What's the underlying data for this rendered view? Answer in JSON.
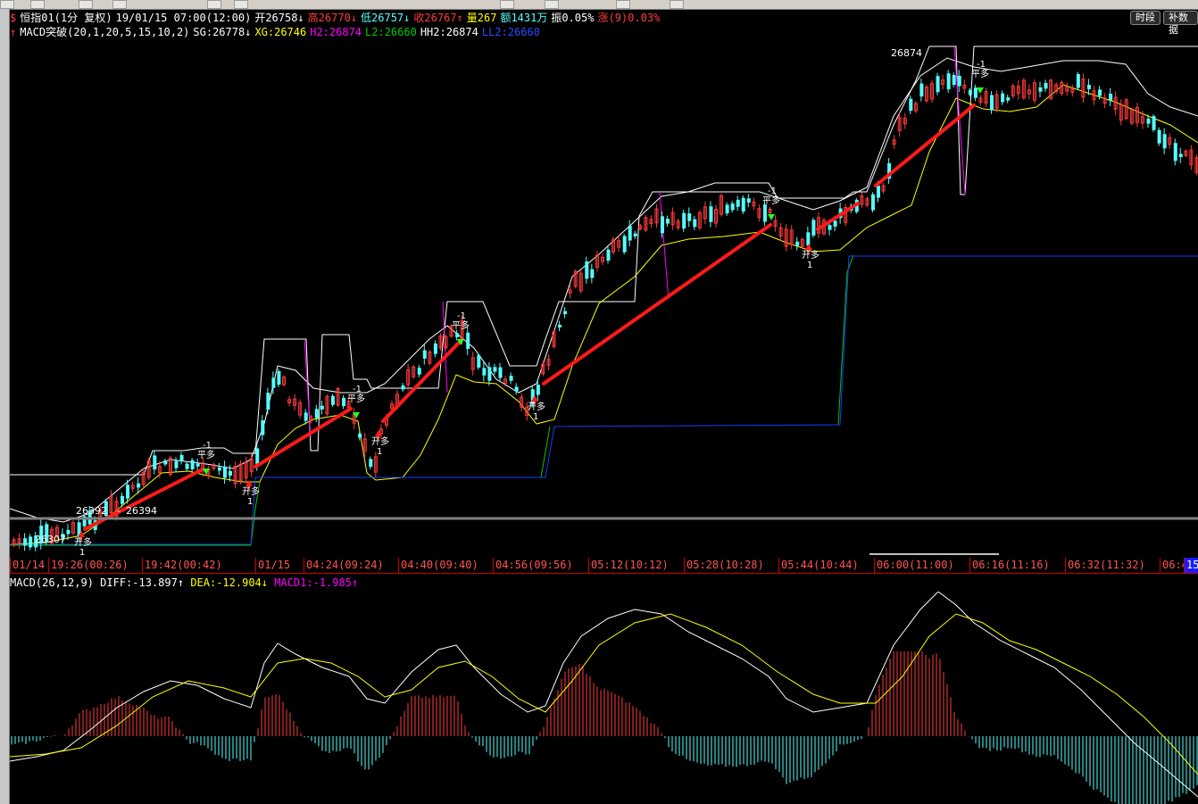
{
  "colors": {
    "bg": "#000000",
    "up": "#ff3b3b",
    "down": "#54ffff",
    "white": "#ffffff",
    "yellow": "#ffff00",
    "magenta": "#ff00ff",
    "green": "#00c800",
    "blue": "#0000ff",
    "arrow": "#ff1a1a",
    "red_text": "#ff3b3b",
    "cyan_text": "#54ffff",
    "text": "#c0c0c0"
  },
  "header": {
    "line1": {
      "icon": "$",
      "symbol": "恒指01(1分 复权)",
      "datetime": "19/01/15 07:00(12:00)",
      "open": "开26758↓",
      "high": "高26770↓",
      "low": "低26757↓",
      "close": "收26767↑",
      "volume": "量267",
      "amount": "额1431万",
      "amplitude": "振0.05%",
      "change": "涨(9)0.03%"
    },
    "line2": {
      "icon": "↑",
      "name": "MACD突破(20,1,20,5,15,10,2)",
      "sg": "SG:26778↓",
      "xg": "XG:26746",
      "h2": "H2:26874",
      "l2": "L2:26660",
      "hh2": "HH2:26874",
      "ll2": "LL2:26660"
    },
    "buttons": {
      "timeseg": "时段",
      "fill": "补数据"
    }
  },
  "price_chart": {
    "type": "candlestick",
    "high_label": "26874",
    "low_label": "26307",
    "range_label_left": "26392",
    "range_label_right": "26394",
    "range_dash": "-",
    "signals": {
      "open_long": "开多",
      "close_long": "平多",
      "num_one": "1",
      "num_minus_one": "-1"
    },
    "candle_count": 220
  },
  "time_axis": {
    "ticks": [
      "01/14",
      "19:26(00:26)",
      "19:42(00:42)",
      "01/15",
      "04:24(09:24)",
      "04:40(09:40)",
      "04:56(09:56)",
      "05:12(10:12)",
      "05:28(10:28)",
      "05:44(10:44)",
      "06:00(11:00)",
      "06:16(11:16)",
      "06:32(11:32)",
      "06:4"
    ],
    "end_badge": "15"
  },
  "macd": {
    "title": "MACD(26,12,9)",
    "diff": "DIFF:-13.897↑",
    "dea": "DEA:-12.904↓",
    "macd1": "MACD1:-1.985↑"
  }
}
